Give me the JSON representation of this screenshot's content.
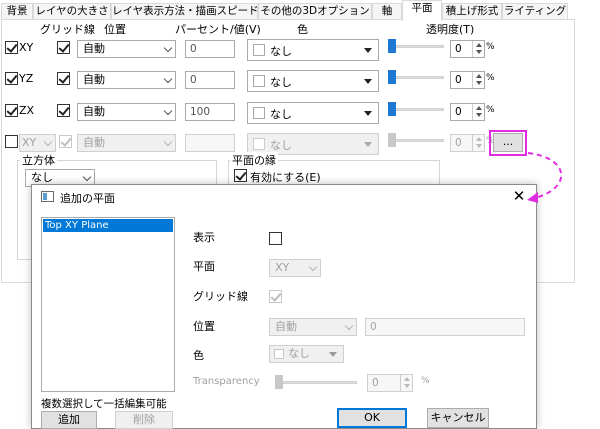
{
  "tabs": [
    "背景",
    "レイヤの大きさ",
    "レイヤ表示方法・描画スピード",
    "その他の3Dオプション",
    "軸",
    "平面",
    "積上げ形式",
    "ライティング"
  ],
  "active_tab": "平面",
  "columns": {
    "grid": "グリッド線",
    "position": "位置",
    "percent": "パーセント/値(V)",
    "color": "色",
    "transparency": "透明度(T)"
  },
  "rows": [
    {
      "plane": "XY",
      "position": "自動",
      "value": "0",
      "color": "なし",
      "transparency": "0",
      "unit": "%"
    },
    {
      "plane": "YZ",
      "position": "自動",
      "value": "0",
      "color": "なし",
      "transparency": "0",
      "unit": "%"
    },
    {
      "plane": "ZX",
      "position": "自動",
      "value": "100",
      "color": "なし",
      "transparency": "0",
      "unit": "%"
    },
    {
      "plane": "XY",
      "position": "自動",
      "value": "",
      "color": "なし",
      "transparency": "0",
      "unit": "%"
    }
  ],
  "more_button": "...",
  "cube_group": {
    "title": "立方体",
    "select": "なし"
  },
  "border_group": {
    "title": "平面の縁",
    "enable_label": "有効にする(E)"
  },
  "dialog": {
    "title": "追加の平面",
    "list_items": [
      "Top XY Plane"
    ],
    "footer_note": "複数選択して一括編集可能",
    "add_button": "追加",
    "delete_button": "削除",
    "show_label": "表示",
    "plane_label": "平面",
    "plane_value": "XY",
    "grid_label": "グリッド線",
    "position_label": "位置",
    "position_value": "自動",
    "position_number": "0",
    "color_label": "色",
    "color_value": "なし",
    "transparency_label": "Transparency",
    "transparency_value": "0",
    "transparency_unit": "%",
    "ok_button": "OK",
    "cancel_button": "キャンセル"
  },
  "colors": {
    "accent": "#0078d7",
    "highlight": "#e22ce1",
    "slider": "#1f78d1"
  }
}
